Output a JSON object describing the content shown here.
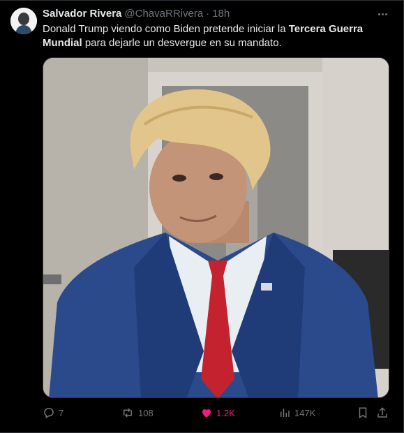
{
  "post": {
    "display_name": "Salvador Rivera",
    "handle": "@ChavaRRivera",
    "separator": "·",
    "time": "18h",
    "text_part1": "Donald Trump viendo como Biden pretende iniciar la ",
    "text_bold": "Tercera Guerra Mundial",
    "text_part2": " para dejarle un desvergue en su mandato."
  },
  "actions": {
    "replies": "7",
    "reposts": "108",
    "likes": "1.2K",
    "views": "147K"
  },
  "colors": {
    "background": "#000000",
    "text_primary": "#e7e9ea",
    "text_secondary": "#71767b",
    "like_active": "#f91880",
    "border": "#2f3336"
  },
  "icons": {
    "reply": "reply-icon",
    "repost": "repost-icon",
    "like": "heart-icon",
    "views": "views-icon",
    "bookmark": "bookmark-icon",
    "share": "share-icon",
    "more": "more-icon"
  }
}
